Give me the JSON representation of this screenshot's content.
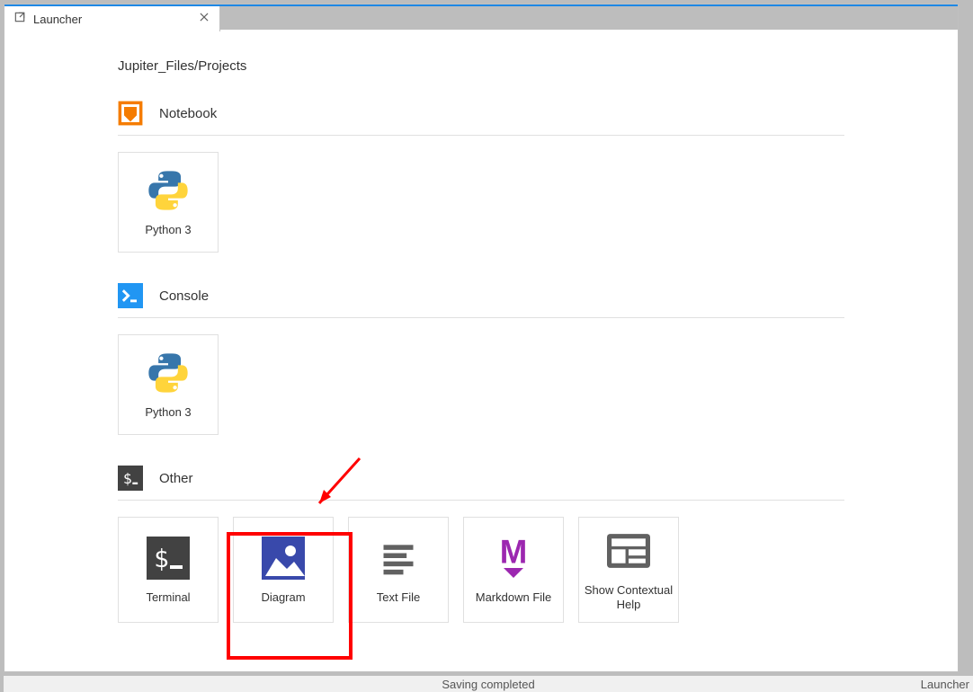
{
  "tab": {
    "title": "Launcher"
  },
  "breadcrumb": "Jupiter_Files/Projects",
  "sections": {
    "notebook": {
      "title": "Notebook",
      "items": [
        {
          "label": "Python 3"
        }
      ]
    },
    "console": {
      "title": "Console",
      "items": [
        {
          "label": "Python 3"
        }
      ]
    },
    "other": {
      "title": "Other",
      "items": [
        {
          "label": "Terminal"
        },
        {
          "label": "Diagram"
        },
        {
          "label": "Text File"
        },
        {
          "label": "Markdown File"
        },
        {
          "label": "Show Contextual Help"
        }
      ]
    }
  },
  "status": {
    "center": "Saving completed",
    "right": "Launcher"
  },
  "colors": {
    "accent_blue": "#2196f3",
    "notebook_orange": "#f57c00",
    "diagram_purple": "#3949ab",
    "markdown_purple": "#9c27b0",
    "terminal_dark": "#424242",
    "highlight_red": "#ff0000"
  }
}
